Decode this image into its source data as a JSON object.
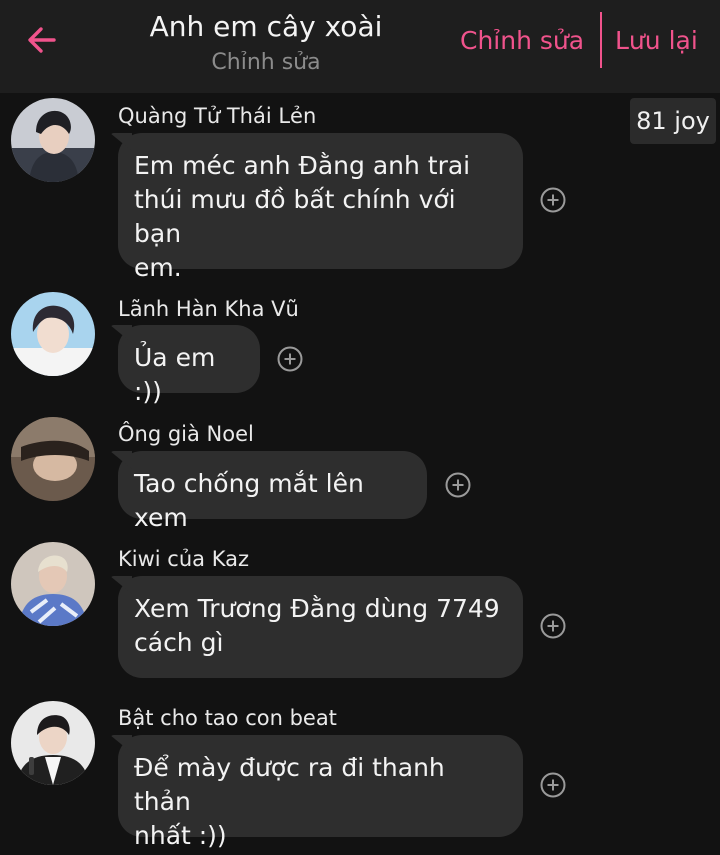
{
  "header": {
    "title": "Anh em cây xoài",
    "subtitle": "Chỉnh sửa",
    "edit_label": "Chỉnh sửa",
    "save_label": "Lưu lại",
    "back_icon": "arrow-left-icon",
    "accent_color": "#f0538c"
  },
  "badge": {
    "label": "81 joy"
  },
  "messages": [
    {
      "sender": "Quàng Tử Thái Lẻn",
      "lines": [
        "Em méc anh Đằng anh trai",
        "thúi mưu đồ bất chính với bạn",
        "em."
      ]
    },
    {
      "sender": "Lãnh Hàn Kha Vũ",
      "lines": [
        "Ủa em :))"
      ]
    },
    {
      "sender": "Ông già Noel",
      "lines": [
        "Tao chống mắt lên xem"
      ]
    },
    {
      "sender": "Kiwi của Kaz",
      "lines": [
        "Xem Trương Đằng dùng 7749",
        "cách gì"
      ]
    },
    {
      "sender": "Bật cho tao con beat",
      "lines": [
        "Để mày được ra đi thanh thản",
        "nhất :))"
      ]
    }
  ],
  "icons": {
    "react": "plus-circle-icon"
  }
}
